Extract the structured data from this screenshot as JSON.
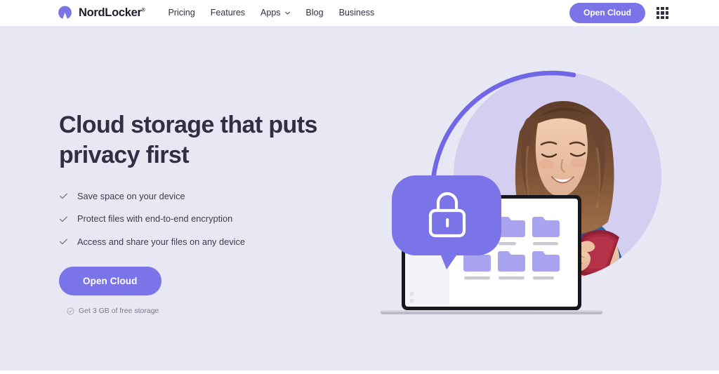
{
  "header": {
    "brand": {
      "name": "NordLocker",
      "trademark": "®",
      "logo_icon": "nordlocker-arch-logo"
    },
    "nav_items": [
      {
        "label": "Pricing",
        "has_dropdown": false
      },
      {
        "label": "Features",
        "has_dropdown": false
      },
      {
        "label": "Apps",
        "has_dropdown": true
      },
      {
        "label": "Blog",
        "has_dropdown": false
      },
      {
        "label": "Business",
        "has_dropdown": false
      }
    ],
    "open_cloud_label": "Open Cloud",
    "apps_launcher_icon": "apps-grid-icon"
  },
  "hero": {
    "headline": "Cloud storage that puts privacy first",
    "bullets": [
      "Save space on your device",
      "Protect files with end-to-end encryption",
      "Access and share your files on any device"
    ],
    "cta_label": "Open Cloud",
    "free_storage_note": "Get 3 GB of free storage",
    "free_storage_icon": "check-circle-icon",
    "bullet_icon": "checkmark-icon"
  },
  "illustration": {
    "lock_badge_icon": "padlock-icon",
    "device_icon": "laptop-file-manager",
    "person_description": "smiling-woman-with-phone",
    "folder_count": 6
  },
  "colors": {
    "brand_purple": "#7b73e8",
    "hero_background": "#e8e7f4",
    "circle_backdrop": "#d4cff0",
    "ring_stroke": "#6f67e6",
    "text_dark": "#2f3043",
    "text_muted": "#7a7b8c",
    "folder_fill": "#a9a3f0"
  }
}
